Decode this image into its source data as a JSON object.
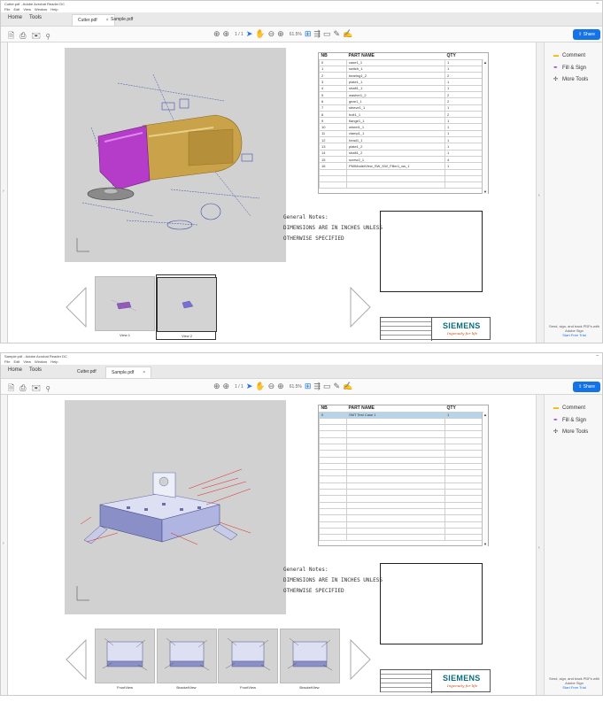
{
  "screens": [
    {
      "window_title": "Cutter.pdf - Adobe Acrobat Reader DC",
      "menu": [
        "File",
        "Edit",
        "View",
        "Window",
        "Help"
      ],
      "nav_tabs": [
        "Home",
        "Tools"
      ],
      "doc_tabs": [
        {
          "label": "Cutter.pdf",
          "active": true
        },
        {
          "label": "Sample.pdf",
          "active": false
        }
      ],
      "page_indicator": "1 / 1",
      "zoom": "61.5%",
      "share_label": "Share",
      "right_tools": [
        {
          "label": "Comment",
          "icon": "comment-icon",
          "color": "#f5b800"
        },
        {
          "label": "Fill & Sign",
          "icon": "fill-sign-icon",
          "color": "#8b2fc9"
        },
        {
          "label": "More Tools",
          "icon": "more-tools-icon",
          "color": "#444444"
        }
      ],
      "promo_text": "Send, sign, and track PDFs with Adobe Sign",
      "promo_link": "Start Free Trial",
      "bom": {
        "headers": [
          "NB",
          "PART NAME",
          "QTY"
        ],
        "rows": [
          [
            "0",
            "case1_1",
            "1"
          ],
          [
            "1",
            "switch_1",
            "1"
          ],
          [
            "2",
            "bearing1_2",
            "2"
          ],
          [
            "3",
            "plate1_1",
            "1"
          ],
          [
            "4",
            "shaft1_1",
            "1"
          ],
          [
            "5",
            "washer1_2",
            "2"
          ],
          [
            "6",
            "gear1_1",
            "2"
          ],
          [
            "7",
            "sleeve1_1",
            "1"
          ],
          [
            "8",
            "bolt1_1",
            "2"
          ],
          [
            "9",
            "flange1_1",
            "1"
          ],
          [
            "10",
            "wheel1_1",
            "1"
          ],
          [
            "11",
            "clamp1_1",
            "1"
          ],
          [
            "12",
            "head1_1",
            "1"
          ],
          [
            "13",
            "plate1_2",
            "1"
          ],
          [
            "14",
            "shaft1_2",
            "1"
          ],
          [
            "15",
            "screw2_1",
            "4"
          ],
          [
            "16",
            "PMIModelView_SW_KW_Filler1_ws_1",
            "1"
          ]
        ],
        "empty_rows": 3,
        "selected_row": -1
      },
      "notes": [
        "General Notes:",
        "DIMENSIONS ARE IN INCHES UNLESS",
        "OTHERWISE SPECIFIED"
      ],
      "siemens_logo": "SIEMENS",
      "siemens_tagline": "Ingenuity for life",
      "thumbnails": [
        {
          "label": "View 1",
          "current": false
        },
        {
          "label": "View 2",
          "current": true
        }
      ]
    },
    {
      "window_title": "Sample.pdf - Adobe Acrobat Reader DC",
      "menu": [
        "File",
        "Edit",
        "View",
        "Window",
        "Help"
      ],
      "nav_tabs": [
        "Home",
        "Tools"
      ],
      "doc_tabs": [
        {
          "label": "Cutter.pdf",
          "active": false
        },
        {
          "label": "Sample.pdf",
          "active": true
        }
      ],
      "page_indicator": "1 / 1",
      "zoom": "61.5%",
      "share_label": "Share",
      "right_tools": [
        {
          "label": "Comment",
          "icon": "comment-icon",
          "color": "#f5b800"
        },
        {
          "label": "Fill & Sign",
          "icon": "fill-sign-icon",
          "color": "#8b2fc9"
        },
        {
          "label": "More Tools",
          "icon": "more-tools-icon",
          "color": "#444444"
        }
      ],
      "promo_text": "Send, sign, and track PDFs with Adobe Sign",
      "promo_link": "Start Free Trial",
      "bom": {
        "headers": [
          "NB",
          "PART NAME",
          "QTY"
        ],
        "rows": [
          [
            "0",
            "SMT Test Case 1",
            "1"
          ]
        ],
        "empty_rows": 19,
        "selected_row": 0
      },
      "notes": [
        "General Notes:",
        "DIMENSIONS ARE IN INCHES UNLESS",
        "OTHERWISE SPECIFIED"
      ],
      "siemens_logo": "SIEMENS",
      "siemens_tagline": "Ingenuity for life",
      "thumbnails": [
        {
          "label": "FrontView",
          "current": false
        },
        {
          "label": "BracketView",
          "current": false
        },
        {
          "label": "FrontView",
          "current": false
        },
        {
          "label": "BracketView",
          "current": false
        }
      ]
    }
  ]
}
